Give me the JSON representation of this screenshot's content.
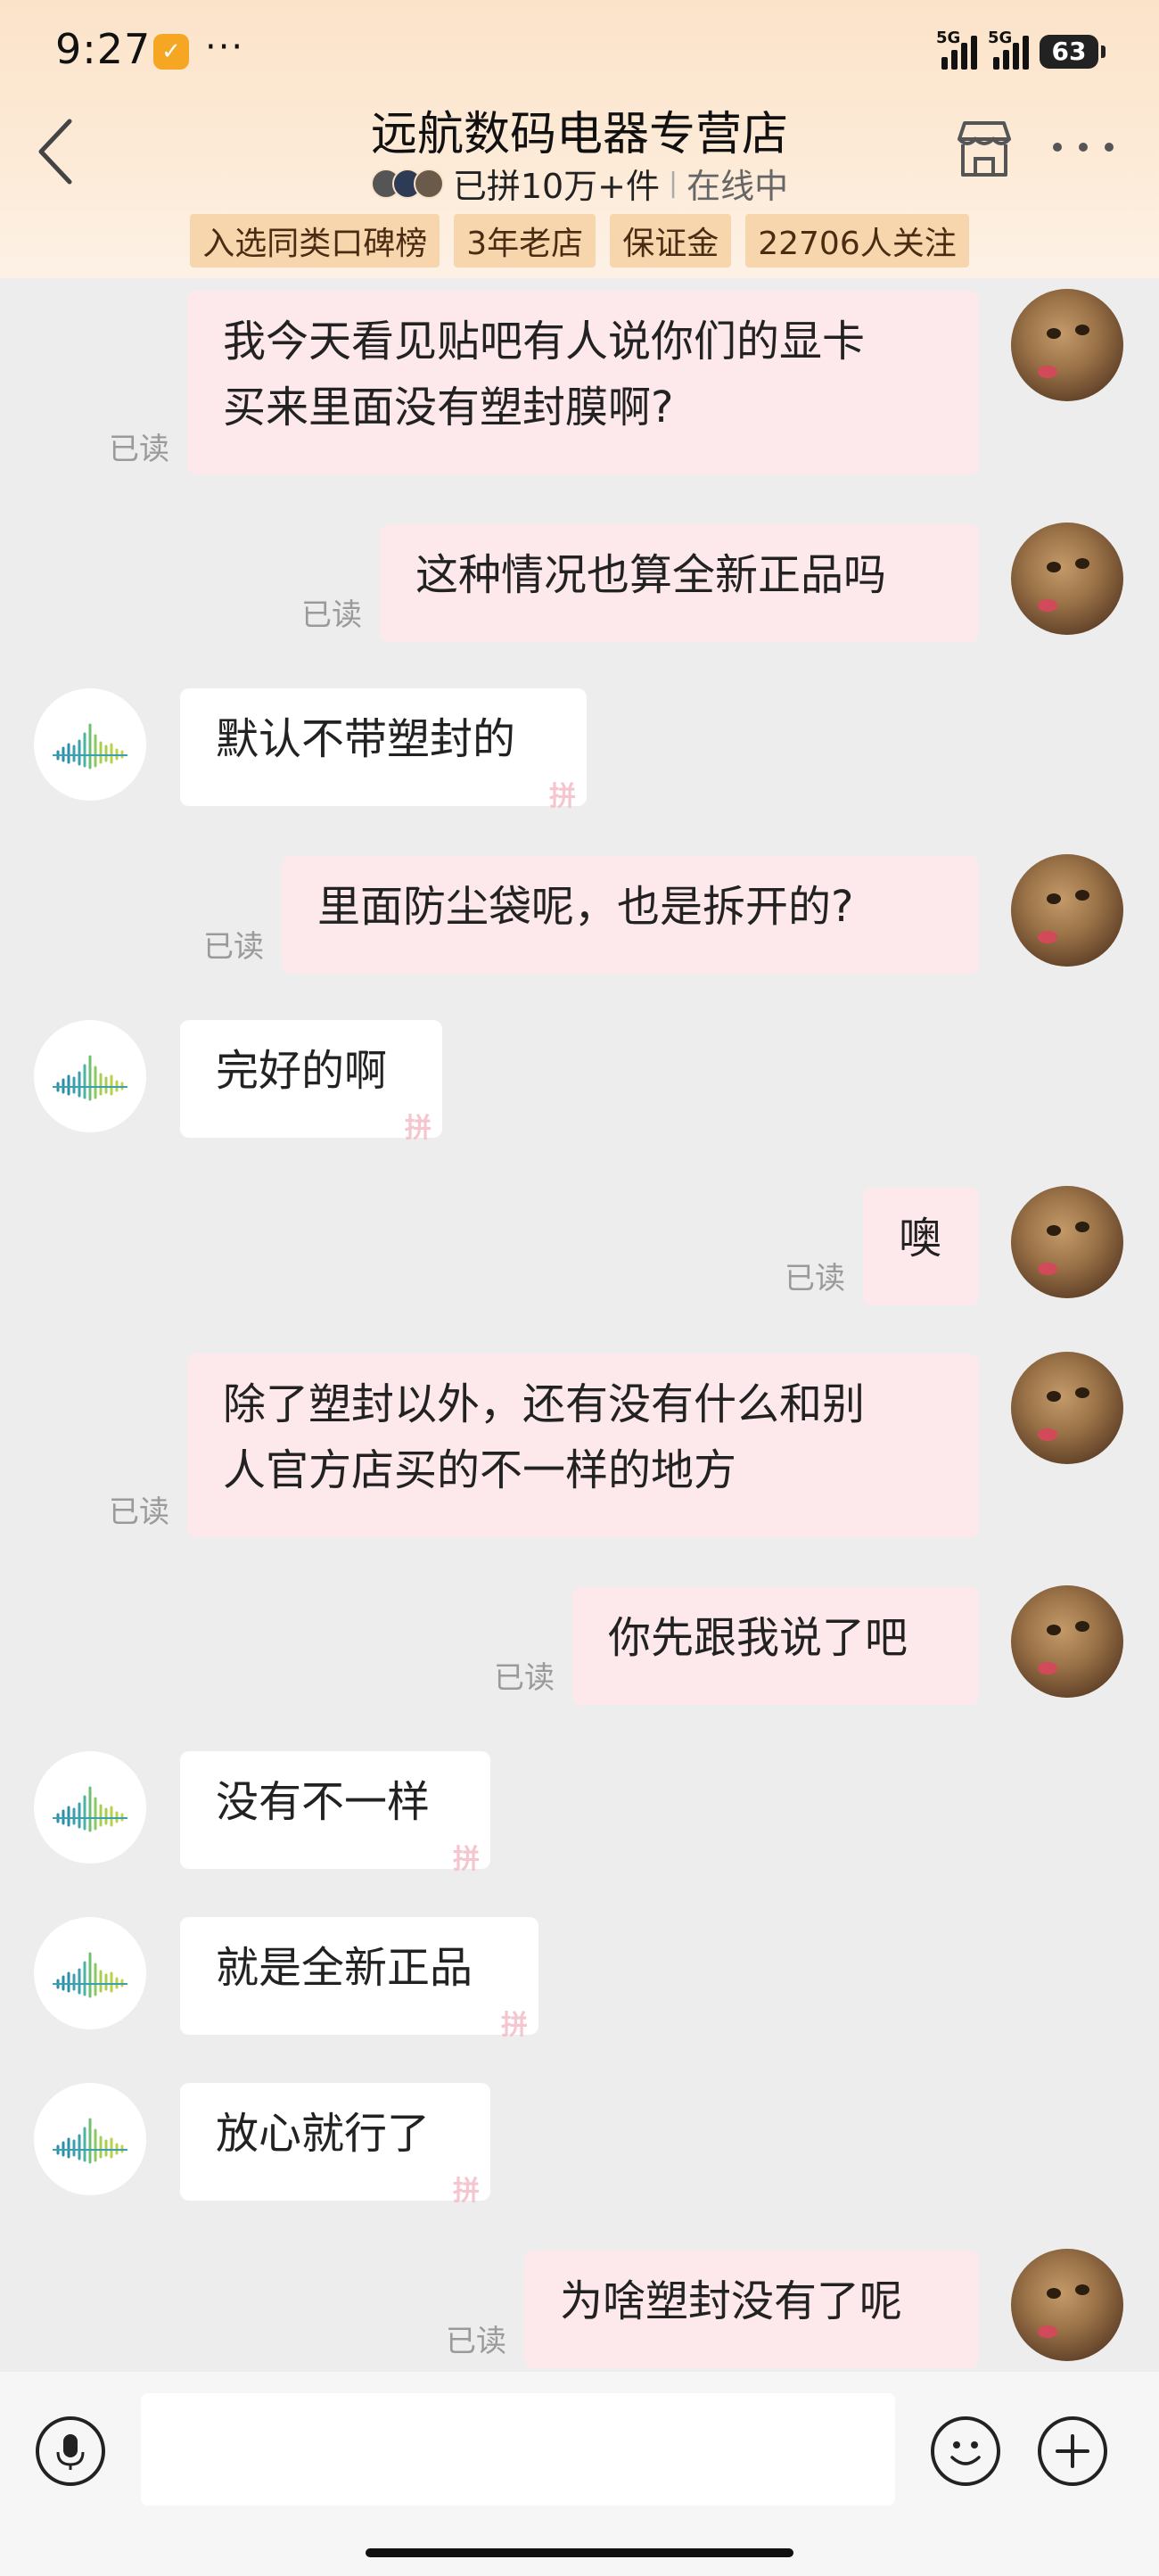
{
  "status_bar": {
    "time": "9:27",
    "more": "···",
    "signal_label_1": "5G",
    "signal_label_2": "5G",
    "battery": "63"
  },
  "header": {
    "title": "远航数码电器专营店",
    "sold": "已拼10万+件",
    "separator": "|",
    "online": "在线中",
    "tags": [
      "入选同类口碑榜",
      "3年老店",
      "保证金",
      "22706人关注"
    ]
  },
  "messages": [
    {
      "from": "me",
      "lines": [
        "我今天看见贴吧有人说你们的显卡",
        "买来里面没有塑封膜啊?"
      ],
      "read": "已读"
    },
    {
      "from": "me",
      "lines": [
        "这种情况也算全新正品吗"
      ],
      "read": "已读"
    },
    {
      "from": "shop",
      "lines": [
        "默认不带塑封的"
      ]
    },
    {
      "from": "me",
      "lines": [
        "里面防尘袋呢，也是拆开的?"
      ],
      "read": "已读"
    },
    {
      "from": "shop",
      "lines": [
        "完好的啊"
      ]
    },
    {
      "from": "me",
      "lines": [
        "噢"
      ],
      "read": "已读"
    },
    {
      "from": "me",
      "lines": [
        "除了塑封以外，还有没有什么和别",
        "人官方店买的不一样的地方"
      ],
      "read": "已读"
    },
    {
      "from": "me",
      "lines": [
        "你先跟我说了吧"
      ],
      "read": "已读"
    },
    {
      "from": "shop",
      "lines": [
        "没有不一样"
      ]
    },
    {
      "from": "shop",
      "lines": [
        "就是全新正品"
      ]
    },
    {
      "from": "shop",
      "lines": [
        "放心就行了"
      ]
    },
    {
      "from": "me",
      "lines": [
        "为啥塑封没有了呢"
      ],
      "read": "已读"
    }
  ],
  "pin_mark": "拼",
  "input": {
    "placeholder": ""
  },
  "colors": {
    "me_bubble": "#fde9ec",
    "shop_bubble": "#ffffff",
    "header_bg": "#fbe3c9",
    "tag_bg": "#f7d6ad"
  }
}
